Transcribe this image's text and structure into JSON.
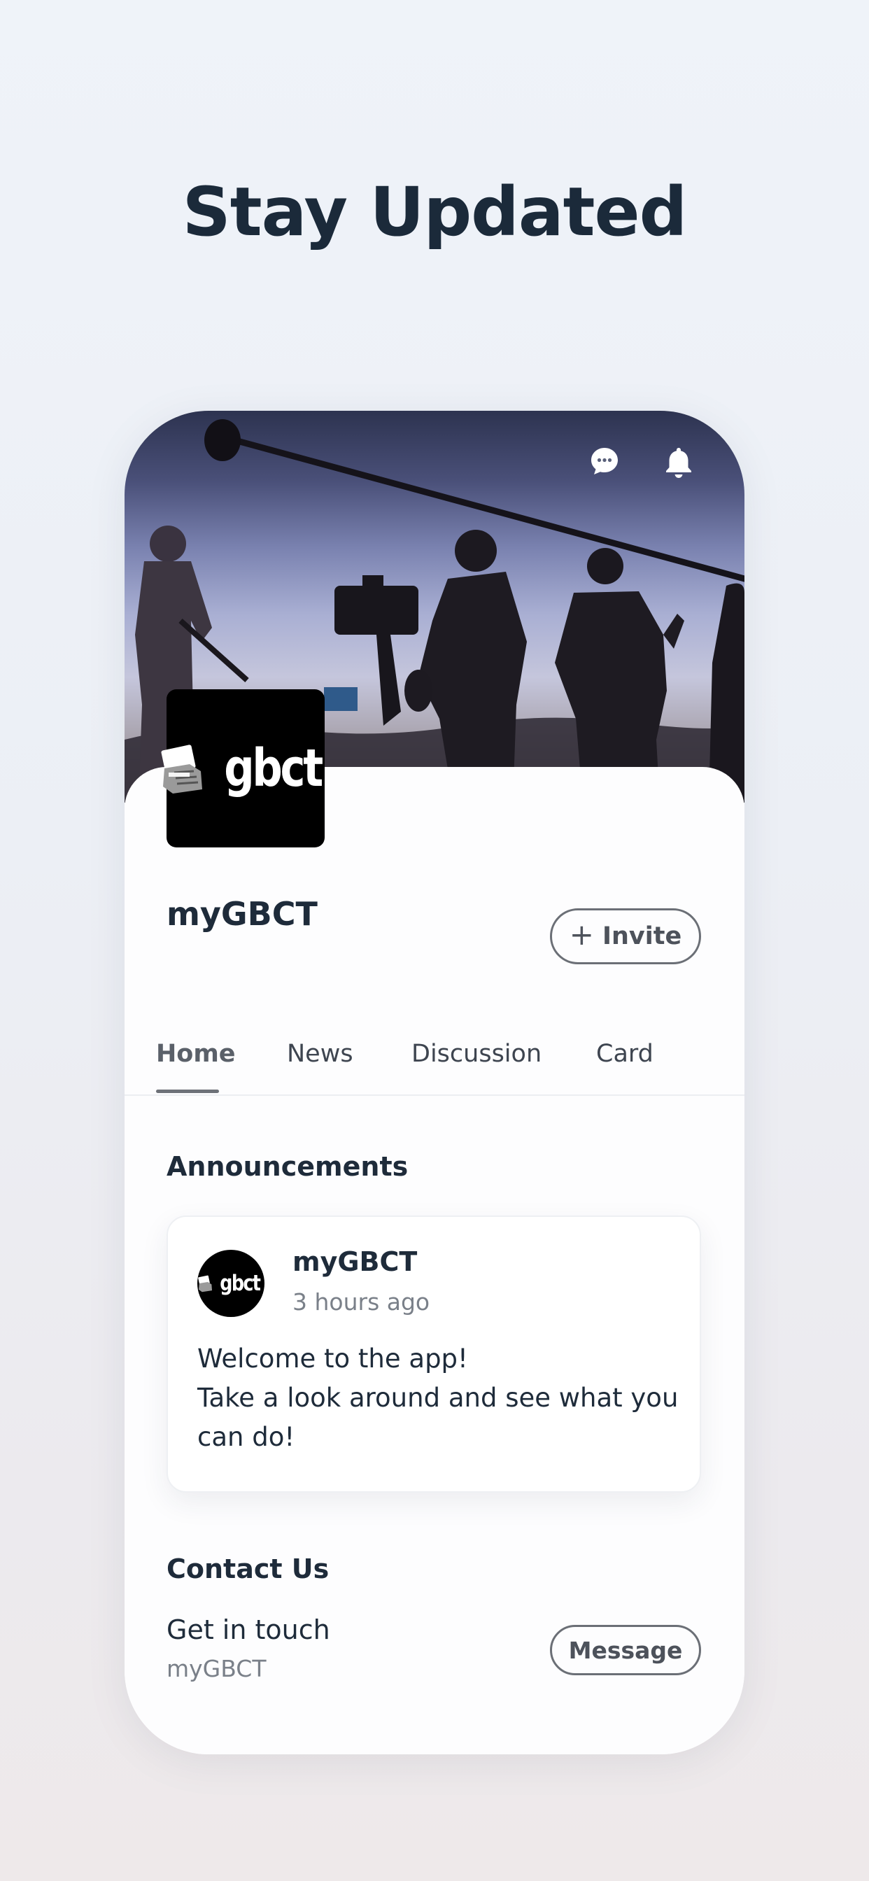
{
  "headline": "Stay Updated",
  "header": {
    "chat_icon": "chat-bubble-icon",
    "bell_icon": "bell-icon"
  },
  "profile": {
    "logo_text": "gbct",
    "name": "myGBCT",
    "invite_label": "Invite",
    "invite_icon": "+"
  },
  "tabs": [
    {
      "label": "Home",
      "active": true
    },
    {
      "label": "News",
      "active": false
    },
    {
      "label": "Discussion",
      "active": false
    },
    {
      "label": "Card",
      "active": false
    }
  ],
  "announcements": {
    "heading": "Announcements",
    "post": {
      "avatar_text": "gbct",
      "author": "myGBCT",
      "time": "3 hours ago",
      "body_line1": "Welcome to the app!",
      "body_line2": "Take a look around and see what you",
      "body_line3": "can do!"
    }
  },
  "contact": {
    "heading": "Contact Us",
    "title": "Get in touch",
    "subtitle": "myGBCT",
    "button_label": "Message"
  },
  "colors": {
    "text_primary": "#1e2b3a",
    "text_secondary": "#7a8089",
    "button_border": "#6b6f76"
  }
}
